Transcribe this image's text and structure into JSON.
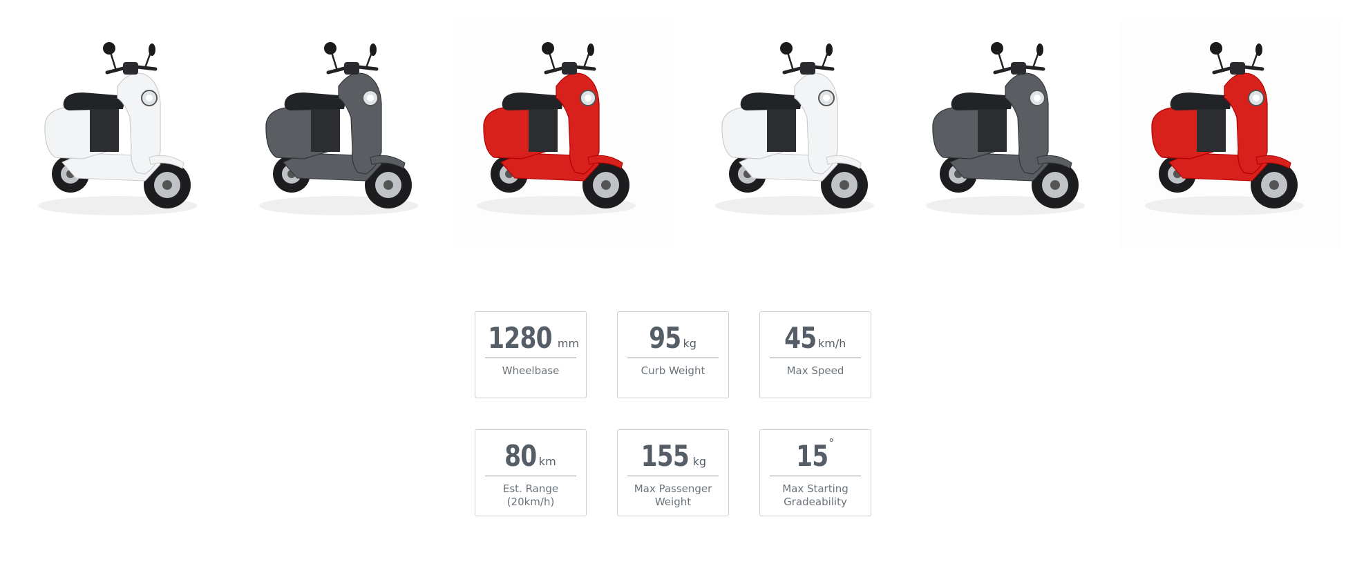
{
  "gallery": {
    "scooters": [
      {
        "color_name": "white",
        "body_color": "#f3f4f5",
        "icon": "scooter-white-icon"
      },
      {
        "color_name": "gray",
        "body_color": "#5a5d61",
        "icon": "scooter-gray-icon"
      },
      {
        "color_name": "red",
        "body_color": "#d8201c",
        "icon": "scooter-red-icon"
      },
      {
        "color_name": "white",
        "body_color": "#f3f4f5",
        "icon": "scooter-white-icon"
      },
      {
        "color_name": "gray",
        "body_color": "#5a5d61",
        "icon": "scooter-gray-icon"
      },
      {
        "color_name": "red",
        "body_color": "#d8201c",
        "icon": "scooter-red-icon"
      }
    ]
  },
  "specs": [
    {
      "value": "1280",
      "unit": "mm",
      "label": "Wheelbase"
    },
    {
      "value": "95",
      "unit": "kg",
      "label": "Curb Weight"
    },
    {
      "value": "45",
      "unit": "km/h",
      "label": "Max Speed"
    },
    {
      "value": "80",
      "unit": "km",
      "label": "Est. Range\n(20km/h)"
    },
    {
      "value": "155",
      "unit": "kg",
      "label": "Max Passenger\nWeight"
    },
    {
      "value": "15",
      "unit": "°",
      "label": "Max Starting\nGradeability"
    }
  ],
  "colors": {
    "spec_text": "#555d66",
    "label_text": "#6b737b",
    "card_border": "#c9ccd0",
    "divider": "#8f969d"
  }
}
